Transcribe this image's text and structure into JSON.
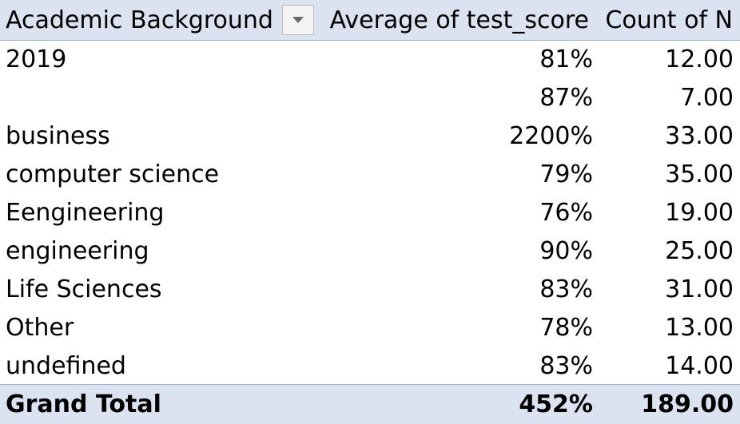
{
  "pivot": {
    "header": {
      "label": "Academic Background",
      "avg": "Average of test_score",
      "count": "Count of N",
      "filter_icon": "dropdown-arrow-icon"
    },
    "rows": [
      {
        "label": "2019",
        "avg": "81%",
        "count": "12.00"
      },
      {
        "label": "",
        "avg": "87%",
        "count": "7.00"
      },
      {
        "label": "business",
        "avg": "2200%",
        "count": "33.00"
      },
      {
        "label": "computer science",
        "avg": "79%",
        "count": "35.00"
      },
      {
        "label": "Eengineering",
        "avg": "76%",
        "count": "19.00"
      },
      {
        "label": "engineering",
        "avg": "90%",
        "count": "25.00"
      },
      {
        "label": "Life Sciences",
        "avg": "83%",
        "count": "31.00"
      },
      {
        "label": "Other",
        "avg": "78%",
        "count": "13.00"
      },
      {
        "label": "undefined",
        "avg": "83%",
        "count": "14.00"
      }
    ],
    "total": {
      "label": "Grand Total",
      "avg": "452%",
      "count": "189.00"
    }
  },
  "colors": {
    "header_bg": "#dce3f0",
    "header_border": "#9db0d3"
  }
}
